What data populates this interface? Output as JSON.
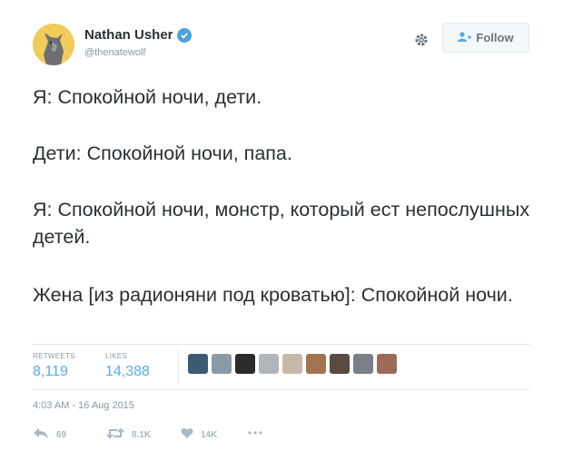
{
  "author": {
    "name": "Nathan Usher",
    "handle": "@thenatewolf",
    "verified": true
  },
  "follow_button": {
    "label": "Follow"
  },
  "tweet": {
    "line1": "Я: Спокойной ночи, дети.",
    "line2": "Дети: Спокойной ночи, папа.",
    "line3": "Я: Спокойной ночи, монстр, который ест непослушных детей.",
    "line4": "Жена [из радионяни под кроватью]: Спокойной ночи."
  },
  "stats": {
    "retweets_label": "RETWEETS",
    "retweets_value": "8,119",
    "likes_label": "LIKES",
    "likes_value": "14,388"
  },
  "timestamp": "4:03 AM - 16 Aug 2015",
  "actions": {
    "reply_count": "69",
    "retweet_count": "8.1K",
    "like_count": "14K"
  },
  "icons": [
    "wolf-avatar",
    "verified-badge-icon",
    "gear-icon",
    "follow-person-icon",
    "reply-icon",
    "retweet-icon",
    "heart-icon",
    "more-icon"
  ],
  "colors": {
    "accent": "#55acee",
    "text": "#292f33",
    "muted": "#8899a6",
    "verified": "#4aa3df"
  }
}
